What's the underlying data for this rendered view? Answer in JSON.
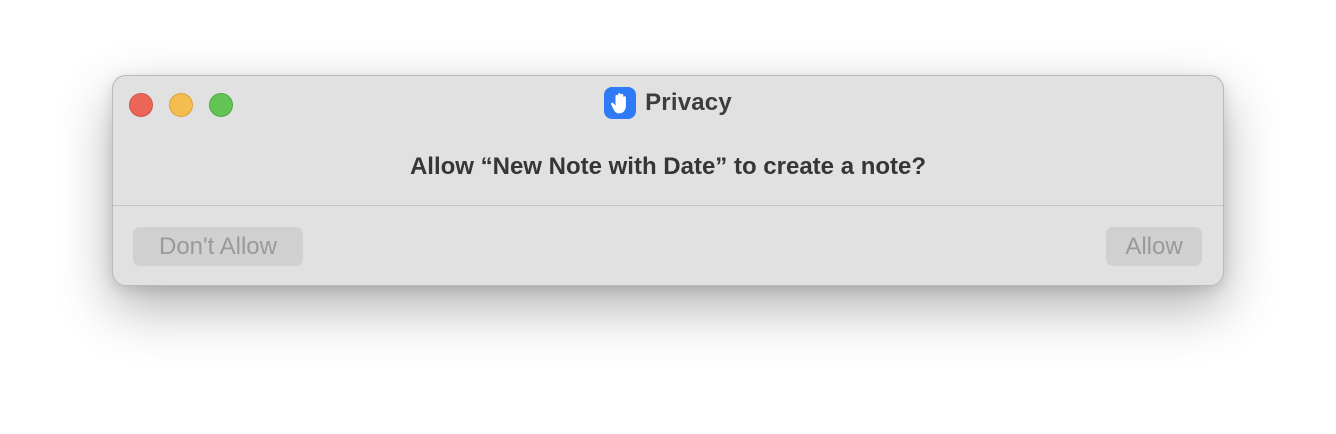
{
  "window": {
    "title": "Privacy",
    "app_icon": "raised-hand-icon",
    "accent_color": "#2f7bf6"
  },
  "dialog": {
    "message": "Allow “New Note with Date” to create a note?",
    "dont_allow_label": "Don't Allow",
    "allow_label": "Allow"
  },
  "traffic_lights": {
    "close_color": "#ec6559",
    "minimize_color": "#f4bd4f",
    "zoom_color": "#61c454"
  }
}
